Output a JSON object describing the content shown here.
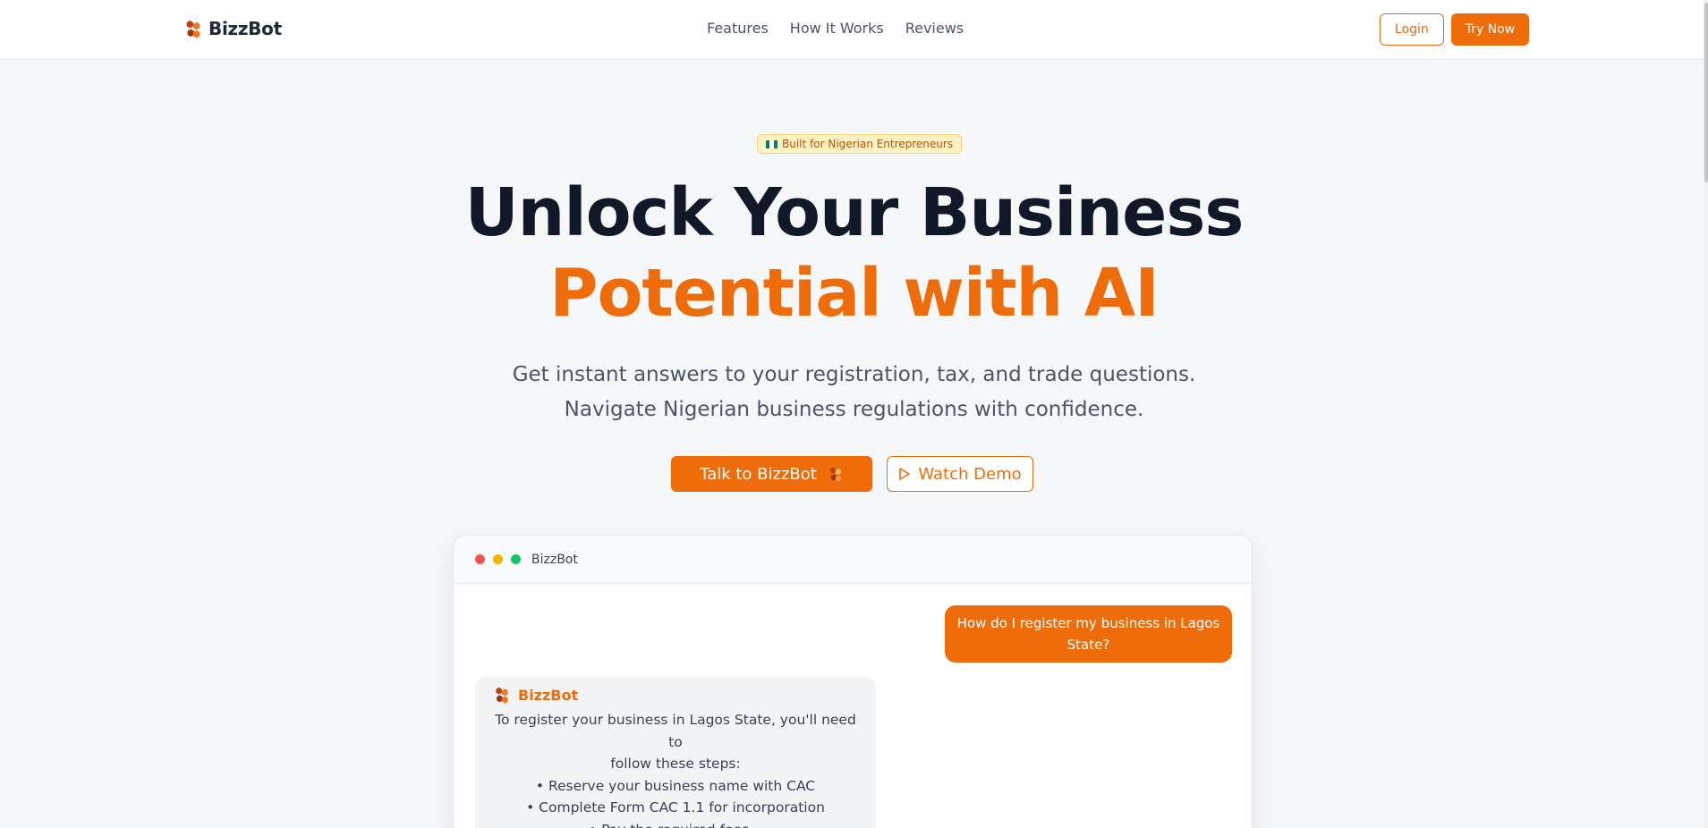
{
  "brand": {
    "name": "BizzBot",
    "logo_icon": "hexagon-cluster-icon",
    "accent": "#ef6c0a"
  },
  "nav": {
    "links": [
      "Features",
      "How It Works",
      "Reviews"
    ],
    "login_label": "Login",
    "try_label": "Try Now"
  },
  "hero": {
    "badge_flag_icon": "nigeria-flag-icon",
    "badge_text": "Built for Nigerian Entrepreneurs",
    "title_line1": "Unlock Your Business",
    "title_line2": "Potential with AI",
    "subtitle_line1": "Get instant answers to your registration, tax, and trade questions.",
    "subtitle_line2": "Navigate Nigerian business regulations with confidence.",
    "cta_primary": "Talk to BizzBot",
    "cta_secondary": "Watch Demo"
  },
  "chat": {
    "window_title": "BizzBot",
    "window_dots": [
      "#f05252",
      "#f5b400",
      "#10c46a"
    ],
    "user_message": "How do I register my business in Lagos State?",
    "bot_name": "BizzBot",
    "bot_lines": [
      "To register your business in Lagos State, you'll need to",
      "follow these steps:",
      "• Reserve your business name with CAC",
      "• Complete Form CAC 1.1 for incorporation",
      "• Pay the required fees..."
    ]
  }
}
